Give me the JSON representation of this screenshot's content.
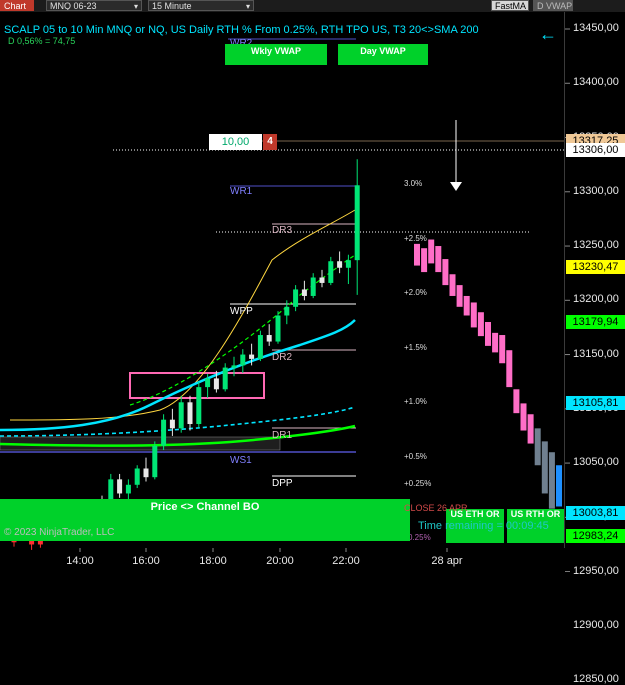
{
  "toolbar": {
    "chart_label": "Chart",
    "instrument": "MNQ 06-23",
    "interval": "15 Minute",
    "fastma": "FastMA",
    "dvwap": "D VWAP"
  },
  "header": {
    "title": "SCALP 05 to 10 Min MNQ or NQ, US Daily RTH % From 0.25%, RTH TPO US, T3 20<>SMA 200",
    "subtitle": "D 0,56% = 74,75"
  },
  "buttons": {
    "weekly_vwap": "Wkly VWAP",
    "day_vwap": "Day VWAP",
    "channel": "Price <> Channel BO",
    "eth_or": "US ETH OR",
    "rth_or": "US RTH OR"
  },
  "order": {
    "price": "10,00",
    "qty": "4"
  },
  "levels": [
    {
      "label": "WR2",
      "color": "#8080ff"
    },
    {
      "label": "WR1",
      "color": "#8080ff"
    },
    {
      "label": "DR3",
      "color": "#d8b4c0"
    },
    {
      "label": "WPP",
      "color": "#ffffff"
    },
    {
      "label": "DR2",
      "color": "#d8b4c0"
    },
    {
      "label": "DR1",
      "color": "#d8b4c0"
    },
    {
      "label": "WS1",
      "color": "#8080ff"
    },
    {
      "label": "DPP",
      "color": "#ffffff"
    }
  ],
  "pct_levels": [
    "3.0%",
    "+2.5%",
    "+2.0%",
    "+1.5%",
    "+1.0%",
    "+0.5%",
    "+0.25%",
    "0.25%"
  ],
  "close_label": "CLOSE 26 APR",
  "time_remaining": "Time remaining = 00:09:45",
  "copyright": "© 2023 NinjaTrader, LLC",
  "price_labels": [
    {
      "text": "13317,25",
      "bg": "#f0c896",
      "fg": "#000000"
    },
    {
      "text": "13306,00",
      "bg": "#ffffff",
      "fg": "#000000"
    },
    {
      "text": "13230,47",
      "bg": "#ffff00",
      "fg": "#000000"
    },
    {
      "text": "13179,94",
      "bg": "#00ff00",
      "fg": "#000000"
    },
    {
      "text": "13105,81",
      "bg": "#00e5ff",
      "fg": "#000000"
    },
    {
      "text": "13003,81",
      "bg": "#00e5ff",
      "fg": "#000000"
    },
    {
      "text": "12983,24",
      "bg": "#00ff00",
      "fg": "#000000"
    }
  ],
  "chart_data": {
    "type": "candlestick",
    "yaxis": {
      "ylim": [
        12835,
        13465
      ],
      "ticks": [
        "13450,00",
        "13400,00",
        "13350,00",
        "13300,00",
        "13250,00",
        "13200,00",
        "13150,00",
        "13100,00",
        "13050,00",
        "13000,00",
        "12950,00",
        "12900,00",
        "12850,00"
      ]
    },
    "xaxis": {
      "ticks": [
        "14:00",
        "16:00",
        "18:00",
        "20:00",
        "22:00",
        "28 apr"
      ]
    },
    "candles": {
      "ohlc": [
        [
          12977,
          12993,
          12973,
          12988
        ],
        [
          12988,
          12998,
          12982,
          12985
        ],
        [
          12985,
          12990,
          12970,
          12975
        ],
        [
          12975,
          12992,
          12972,
          12990
        ],
        [
          12990,
          12997,
          12985,
          12993
        ],
        [
          12993,
          13005,
          12990,
          13001
        ],
        [
          13001,
          13006,
          12995,
          12998
        ],
        [
          12998,
          13012,
          12996,
          13009
        ],
        [
          13009,
          13013,
          13000,
          13003
        ],
        [
          13003,
          13015,
          13001,
          13012
        ],
        [
          13012,
          13020,
          13008,
          13010
        ],
        [
          13010,
          13040,
          13008,
          13035
        ],
        [
          13035,
          13040,
          13018,
          13022
        ],
        [
          13022,
          13035,
          13015,
          13030
        ],
        [
          13030,
          13048,
          13027,
          13045
        ],
        [
          13045,
          13055,
          13033,
          13037
        ],
        [
          13037,
          13070,
          13035,
          13066
        ],
        [
          13066,
          13095,
          13062,
          13090
        ],
        [
          13090,
          13100,
          13075,
          13082
        ],
        [
          13082,
          13112,
          13078,
          13106
        ],
        [
          13106,
          13112,
          13080,
          13086
        ],
        [
          13086,
          13125,
          13083,
          13120
        ],
        [
          13120,
          13132,
          13110,
          13128
        ],
        [
          13128,
          13135,
          13115,
          13118
        ],
        [
          13118,
          13142,
          13116,
          13138
        ],
        [
          13138,
          13148,
          13130,
          13140
        ],
        [
          13140,
          13155,
          13133,
          13150
        ],
        [
          13150,
          13160,
          13140,
          13146
        ],
        [
          13146,
          13172,
          13144,
          13168
        ],
        [
          13168,
          13178,
          13158,
          13162
        ],
        [
          13162,
          13190,
          13160,
          13186
        ],
        [
          13186,
          13200,
          13178,
          13194
        ],
        [
          13194,
          13214,
          13190,
          13210
        ],
        [
          13210,
          13218,
          13200,
          13204
        ],
        [
          13204,
          13225,
          13202,
          13221
        ],
        [
          13221,
          13228,
          13212,
          13216
        ],
        [
          13216,
          13240,
          13214,
          13236
        ],
        [
          13236,
          13245,
          13225,
          13230
        ],
        [
          13230,
          13242,
          13215,
          13237
        ],
        [
          13237,
          13330,
          13205,
          13306
        ]
      ],
      "first_bullish_day": [
        0,
        1,
        2,
        3
      ],
      "up_color": "#00e676",
      "down_color": "#e8e8e8"
    },
    "projection_columns": {
      "values": [
        [
          13232,
          13252
        ],
        [
          13226,
          13248
        ],
        [
          13234,
          13256
        ],
        [
          13226,
          13250
        ],
        [
          13214,
          13238
        ],
        [
          13204,
          13224
        ],
        [
          13194,
          13214
        ],
        [
          13186,
          13204
        ],
        [
          13175,
          13198
        ],
        [
          13167,
          13189
        ],
        [
          13158,
          13180
        ],
        [
          13152,
          13170
        ],
        [
          13142,
          13168
        ],
        [
          13120,
          13154
        ],
        [
          13096,
          13118
        ],
        [
          13080,
          13105
        ],
        [
          13068,
          13095
        ],
        [
          13048,
          13082
        ],
        [
          13022,
          13070
        ],
        [
          13008,
          13060
        ],
        [
          13010,
          13048
        ]
      ],
      "pink_color": "#ff6ec7",
      "gray_color": "#708090",
      "blue_last_color": "#1e90ff"
    },
    "lines": [
      {
        "color": "#ffd740",
        "style": "solid"
      },
      {
        "color": "#00ff00",
        "style": "dashed"
      },
      {
        "color": "#00e5ff",
        "style": "solid"
      },
      {
        "color": "#00e5ff",
        "style": "dashed"
      },
      {
        "color": "#00ff00",
        "style": "solid"
      }
    ]
  }
}
